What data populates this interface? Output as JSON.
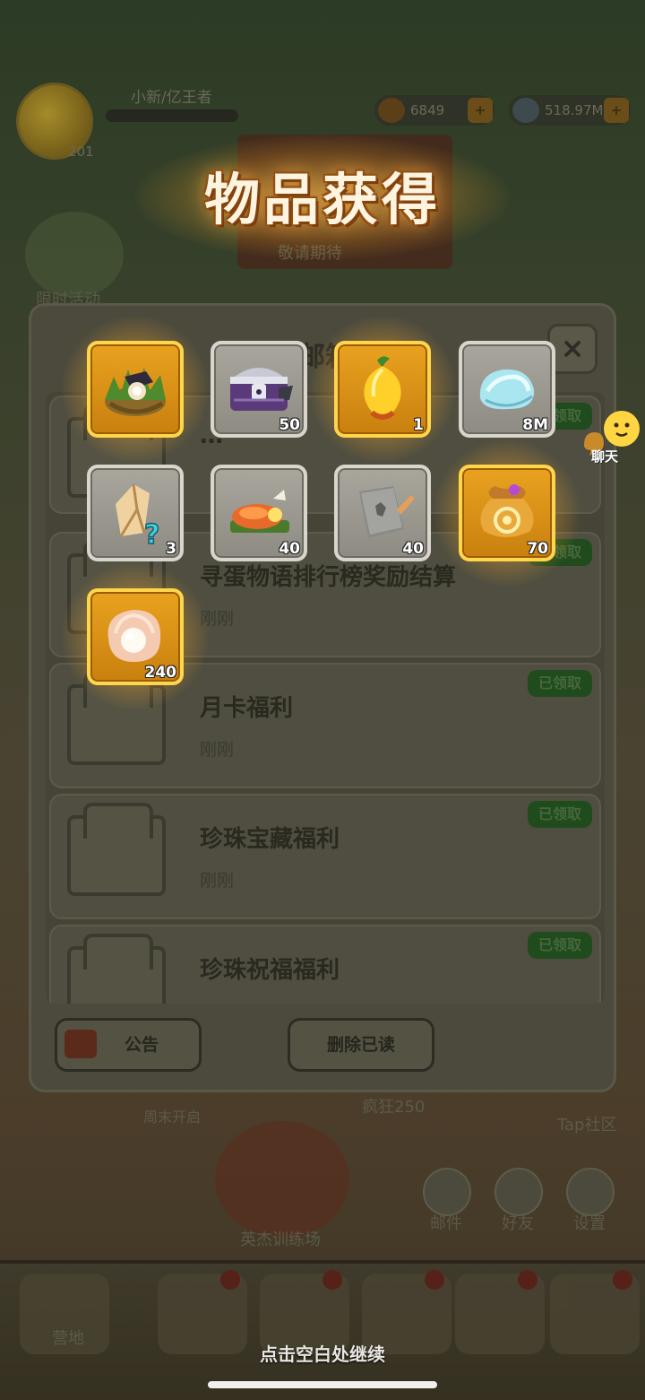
{
  "background": {
    "player_name": "小新/亿王者",
    "level": "201",
    "gold_amount": "6849",
    "gem_amount": "518.97M",
    "event_label_left": "限时活动",
    "event_label_banner": "敬请期待",
    "label_training": "英杰训练场",
    "label_crazy": "疯狂250",
    "label_taptap": "Tap社区",
    "label_weekend": "周末开启",
    "label_mail": "邮件",
    "label_friends": "好友",
    "label_settings": "设置",
    "label_camp": "营地"
  },
  "mailbox": {
    "title": "邮箱",
    "close_symbol": "×",
    "items": [
      {
        "title": "…",
        "time": "",
        "status": "已领取"
      },
      {
        "title": "寻蛋物语排行榜奖励结算",
        "time": "刚刚",
        "status": "已领取"
      },
      {
        "title": "月卡福利",
        "time": "刚刚",
        "status": "已领取"
      },
      {
        "title": "珍珠宝藏福利",
        "time": "刚刚",
        "status": "已领取"
      },
      {
        "title": "珍珠祝福福利",
        "time": "",
        "status": "已领取"
      }
    ],
    "announce_button": "公告",
    "delete_read_button": "删除已读"
  },
  "reward": {
    "title": "物品获得",
    "items": [
      {
        "name": "treasure-nest-icon",
        "quantity": "",
        "rarity": "gold"
      },
      {
        "name": "purple-chest-icon",
        "quantity": "50",
        "rarity": "silver"
      },
      {
        "name": "golden-fruit-icon",
        "quantity": "1",
        "rarity": "gold"
      },
      {
        "name": "pearl-shell-icon",
        "quantity": "8M",
        "rarity": "silver"
      },
      {
        "name": "mystery-crystal-icon",
        "quantity": "3",
        "rarity": "silver"
      },
      {
        "name": "meat-platter-icon",
        "quantity": "40",
        "rarity": "silver"
      },
      {
        "name": "stone-tablet-icon",
        "quantity": "40",
        "rarity": "silver"
      },
      {
        "name": "coin-pouch-icon",
        "quantity": "70",
        "rarity": "gold"
      },
      {
        "name": "pearl-oyster-icon",
        "quantity": "240",
        "rarity": "gold"
      }
    ],
    "continue_hint": "点击空白处继续"
  },
  "chat": {
    "label": "聊天"
  },
  "colors": {
    "gold_frame": "#ffd54a",
    "silver_frame": "#d9d5cc",
    "title_glow": "#ffb44a",
    "claimed_badge": "#1f4b1d"
  }
}
